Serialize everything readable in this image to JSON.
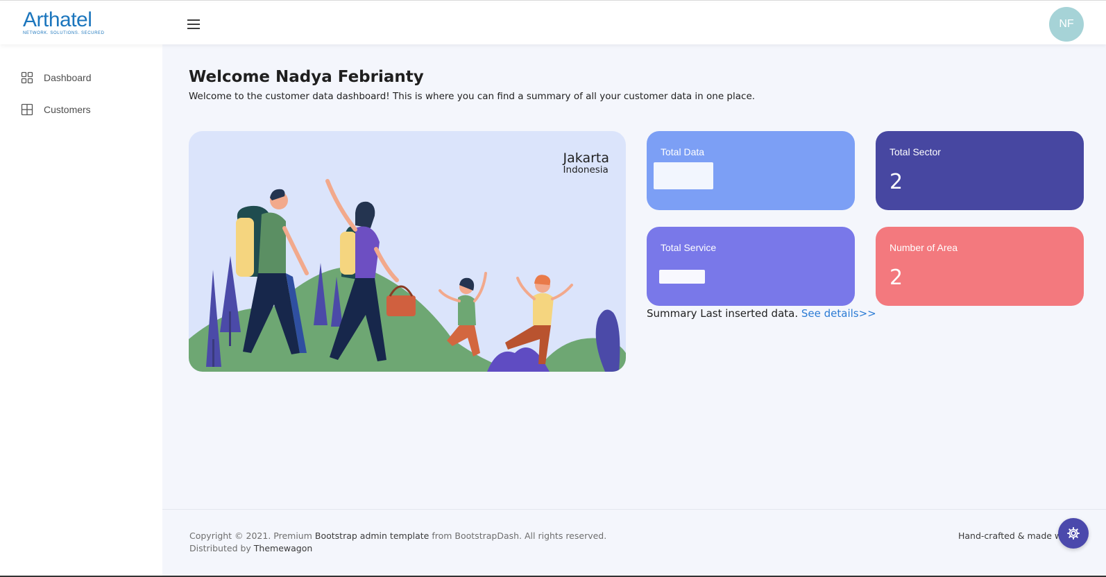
{
  "brand": {
    "name": "Arthatel",
    "tagline": "NETWORK. SOLUTIONS. SECURED",
    "color": "#1c76bd"
  },
  "header": {
    "menu_icon": "hamburger-menu-icon",
    "avatar_initials": "NF",
    "avatar_color": "#a6d3d7"
  },
  "sidebar": {
    "items": [
      {
        "label": "Dashboard",
        "icon": "grid-icon"
      },
      {
        "label": "Customers",
        "icon": "table-icon"
      }
    ]
  },
  "main": {
    "welcome_title": "Welcome Nadya Febrianty",
    "welcome_subtitle": "Welcome to the customer data dashboard! This is where you can find a summary of all your customer data in one place.",
    "hero": {
      "city": "Jakarta",
      "country": "Indonesia"
    },
    "cards": [
      {
        "title": "Total Data",
        "value": "",
        "color": "#7c9ff5"
      },
      {
        "title": "Total Sector",
        "value": "2",
        "color": "#4747a1"
      },
      {
        "title": "Total Service",
        "value": "",
        "color": "#7978e9"
      },
      {
        "title": "Number of Area",
        "value": "2",
        "color": "#f3797e"
      }
    ],
    "summary_text": "Summary Last inserted data.",
    "summary_link": "See details>>"
  },
  "footer": {
    "copyright_prefix": "Copyright © 2021. Premium",
    "template_link": "Bootstrap admin template",
    "copyright_suffix": "from BootstrapDash. All rights reserved.",
    "distributed_prefix": "Distributed by",
    "distributor_link": "Themewagon",
    "right_text": "Hand-crafted & made wi",
    "settings_icon": "gear-icon",
    "settings_color": "#4b49ac"
  }
}
